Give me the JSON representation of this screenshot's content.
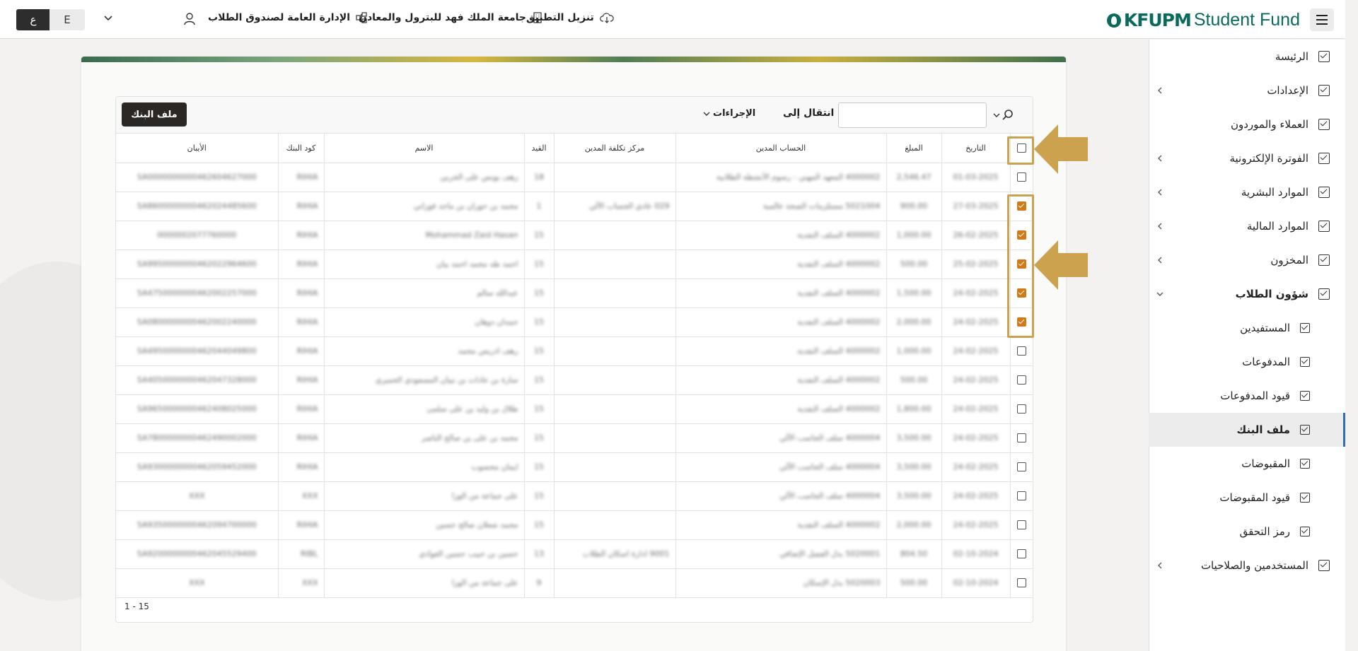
{
  "header": {
    "lang_ar": "ع",
    "lang_en": "E",
    "admin_label": "الإدارة العامة لصندوق الطلاب",
    "university_label": "جامعة الملك فهد للبترول والمعادن",
    "download_label": "تنزيل التطبيق",
    "logo_bold": "KFUPM",
    "logo_light": "Student Fund"
  },
  "sidebar": {
    "items": [
      {
        "label": "الرئيسة"
      },
      {
        "label": "الإعدادات"
      },
      {
        "label": "العملاء والموردون"
      },
      {
        "label": "الفوترة الإلكترونية"
      },
      {
        "label": "الموارد البشرية"
      },
      {
        "label": "الموارد المالية"
      },
      {
        "label": "المخزون"
      },
      {
        "label": "شؤون الطلاب"
      },
      {
        "label": "المستفيدين"
      },
      {
        "label": "المدفوعات"
      },
      {
        "label": "قيود المدفوعات"
      },
      {
        "label": "ملف البنك"
      },
      {
        "label": "المقبوضات"
      },
      {
        "label": "قيود المقبوضات"
      },
      {
        "label": "رمز التحقق"
      },
      {
        "label": "المستخدمين والصلاحيات"
      }
    ]
  },
  "toolbar": {
    "bank_button": "ملف البنك",
    "actions_label": "الإجراءات",
    "goto_label": "انتقال إلى",
    "search_placeholder": ""
  },
  "table": {
    "headers": [
      "التاريخ",
      "المبلغ",
      "الحساب المدين",
      "مركز تكلفة المدين",
      "القيد",
      "الاسم",
      "كود البنك",
      "الأيبان"
    ],
    "rows": [
      {
        "checked": false,
        "cells": [
          "01-03-2025",
          "2,546.47",
          "4000002 المعهد المهني - رسوم الأنشطة الطلابية",
          "",
          "18",
          "رهف يونس على الحربي",
          "RIHIA",
          "SA0000000000462604627000"
        ]
      },
      {
        "checked": true,
        "cells": [
          "27-03-2025",
          "900.00",
          "5021004 مستلزمات الصحة عالمية",
          "029 عادي الحساب الآلي",
          "1",
          "محمد بن حوران بن ماجد فوزاني",
          "RIHIA",
          "SA8600000000462024485600"
        ]
      },
      {
        "checked": true,
        "cells": [
          "26-02-2025",
          "1,000.00",
          "4000002 السلف النقدية",
          "",
          "15",
          "Mohammad Zaid Hasan",
          "RIHIA",
          "0000002077760000"
        ]
      },
      {
        "checked": true,
        "cells": [
          "25-02-2025",
          "500.00",
          "4000002 السلف النقدية",
          "",
          "15",
          "احمد طه محمد احمد بيان",
          "RIHIA",
          "SA9950000000462022964600"
        ]
      },
      {
        "checked": true,
        "cells": [
          "24-02-2025",
          "1,500.00",
          "4000002 السلف النقدية",
          "",
          "15",
          "عبدالله سالم",
          "RIHIA",
          "SA4750000000462002257000"
        ]
      },
      {
        "checked": true,
        "cells": [
          "24-02-2025",
          "2,000.00",
          "4000002 السلف النقدية",
          "",
          "15",
          "حمدان دوهان",
          "RIHIA",
          "SA0800000000462002240000"
        ]
      },
      {
        "checked": false,
        "cells": [
          "24-02-2025",
          "1,000.00",
          "4000002 السلف النقدية",
          "",
          "15",
          "رهف ادريس محمد",
          "RIHIA",
          "SA4950000000462044049800"
        ]
      },
      {
        "checked": false,
        "cells": [
          "24-02-2025",
          "500.00",
          "4000002 السلف النقدية",
          "",
          "15",
          "سارة بن عادات بن تبيان المسعودي الحميري",
          "RIHIA",
          "SA4050000000462047328000"
        ]
      },
      {
        "checked": false,
        "cells": [
          "24-02-2025",
          "1,800.00",
          "4000002 السلف النقدية",
          "",
          "15",
          "طلال بن وليد بن على سلمى",
          "RIHIA",
          "SA9650000000462408025000"
        ]
      },
      {
        "checked": false,
        "cells": [
          "24-02-2025",
          "3,500.00",
          "4000004 سلف الحاسب الآلي",
          "",
          "15",
          "محمد بن على بن صالح الناصر",
          "RIHIA",
          "SA7800000000462490002000"
        ]
      },
      {
        "checked": false,
        "cells": [
          "24-02-2025",
          "3,500.00",
          "4000004 سلف الحاسب الآلي",
          "",
          "15",
          "ايمان محسوب",
          "RIHIA",
          "SA9300000000462059452000"
        ]
      },
      {
        "checked": false,
        "cells": [
          "24-02-2025",
          "3,500.00",
          "4000004 سلف الحاسب الآلي",
          "",
          "15",
          "على جماعة من الوزا",
          "XXX",
          "XXX"
        ]
      },
      {
        "checked": false,
        "cells": [
          "24-02-2025",
          "2,000.00",
          "4000002 السلف النقدية",
          "",
          "15",
          "محمد شعلان صالح حسين",
          "RIHIA",
          "SA9350000000462094700000"
        ]
      },
      {
        "checked": false,
        "cells": [
          "02-10-2024",
          "804.50",
          "5020001 بدل الفصل الإضافي",
          "9001 ادارة اسكان الطلاب",
          "13",
          "حسين بن حبيب حسين الغوادي",
          "RIBL",
          "SA9200000000462045529400"
        ]
      },
      {
        "checked": false,
        "cells": [
          "02-10-2024",
          "500.00",
          "5020003 بدل الإسكان",
          "",
          "9",
          "على جماعة من الوزا",
          "XXX",
          "XXX"
        ]
      }
    ]
  },
  "pager": {
    "label": "1 - 15"
  },
  "colors": {
    "accent_checkbox": "#d27a16",
    "highlight": "#cca24e",
    "primary_button": "#2b2724",
    "logo": "#0a6a5e"
  }
}
